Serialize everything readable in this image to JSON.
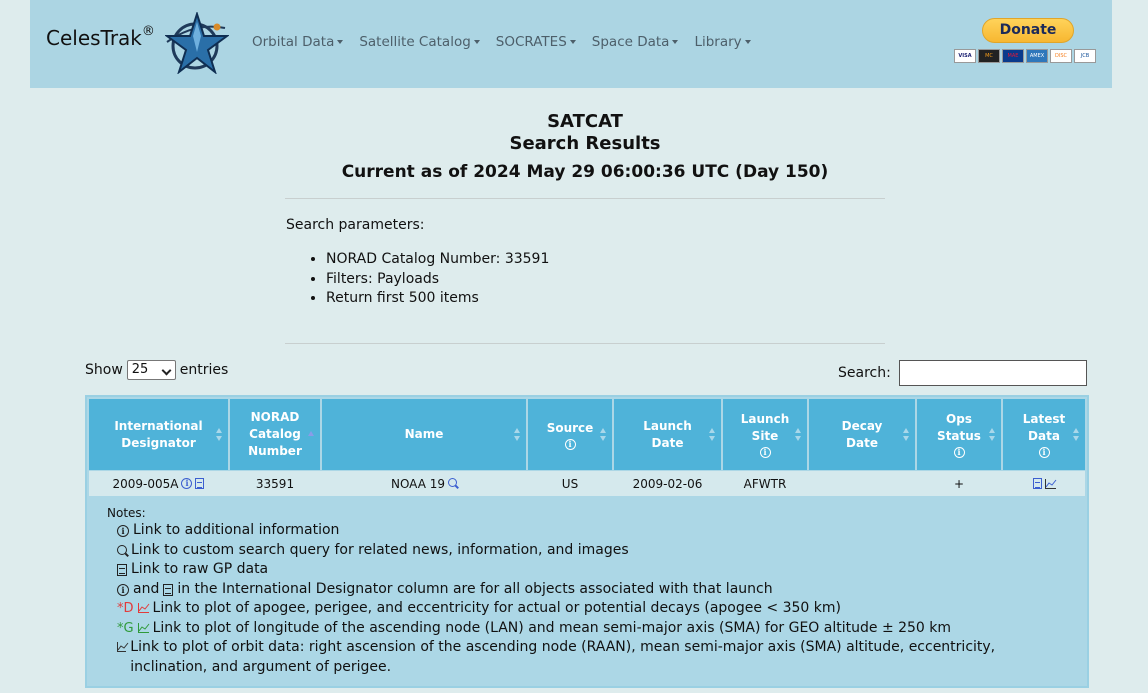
{
  "header": {
    "brand": "CelesTrak",
    "brand_reg": "®",
    "menu": [
      "Orbital Data",
      "Satellite Catalog",
      "SOCRATES",
      "Space Data",
      "Library"
    ],
    "donate_label": "Donate",
    "cards": [
      "VISA",
      "MC",
      "MAE",
      "AMEX",
      "DISC",
      "JCB"
    ]
  },
  "page": {
    "title": "SATCAT",
    "subtitle": "Search Results",
    "current_as_of": "Current as of 2024 May 29 06:00:36 UTC (Day 150)"
  },
  "params": {
    "heading": "Search parameters:",
    "items": [
      "NORAD Catalog Number: 33591",
      "Filters: Payloads",
      "Return first 500 items"
    ]
  },
  "controls": {
    "show_label": "Show",
    "entries_value": "25",
    "entries_label": "entries",
    "search_label": "Search:",
    "search_value": ""
  },
  "table": {
    "headers": [
      {
        "lines": [
          "International",
          "Designator"
        ],
        "info": false
      },
      {
        "lines": [
          "NORAD",
          "Catalog",
          "Number"
        ],
        "info": false
      },
      {
        "lines": [
          "Name"
        ],
        "info": false
      },
      {
        "lines": [
          "Source"
        ],
        "info": true
      },
      {
        "lines": [
          "Launch",
          "Date"
        ],
        "info": false
      },
      {
        "lines": [
          "Launch",
          "Site"
        ],
        "info": true
      },
      {
        "lines": [
          "Decay",
          "Date"
        ],
        "info": false
      },
      {
        "lines": [
          "Ops",
          "Status"
        ],
        "info": true
      },
      {
        "lines": [
          "Latest",
          "Data"
        ],
        "info": true
      }
    ],
    "rows": [
      {
        "intl_designator": "2009-005A",
        "norad": "33591",
        "name": "NOAA 19",
        "source": "US",
        "launch_date": "2009-02-06",
        "launch_site": "AFWTR",
        "decay_date": "",
        "ops_status": "+"
      }
    ]
  },
  "notes": {
    "label": "Notes:",
    "info_line": "Link to additional information",
    "search_line": "Link to custom search query for related news, information, and images",
    "gp_line": "Link to raw GP data",
    "and_word": "and",
    "designator_line": "in the International Designator column are for all objects associated with that launch",
    "decay_prefix": "*D",
    "decay_line": "Link to plot of apogee, perigee, and eccentricity for actual or potential decays (apogee < 350 km)",
    "geo_prefix": "*G",
    "geo_line": "Link to plot of longitude of the ascending node (LAN) and mean semi-major axis (SMA) for GEO altitude ± 250 km",
    "orbit_line": "Link to plot of orbit data: right ascension of the ascending node (RAAN), mean semi-major axis (SMA) altitude, eccentricity, inclination, and argument of perigee."
  },
  "colors": {
    "page_bg": "#deeced",
    "navbar_bg": "#acd5e3",
    "table_header_bg": "#4fb3d9",
    "row_bg": "#d5e9ed",
    "link_blue": "#3c5fd0",
    "decay_red": "#e23b3b",
    "geo_green": "#2f9a3a"
  }
}
